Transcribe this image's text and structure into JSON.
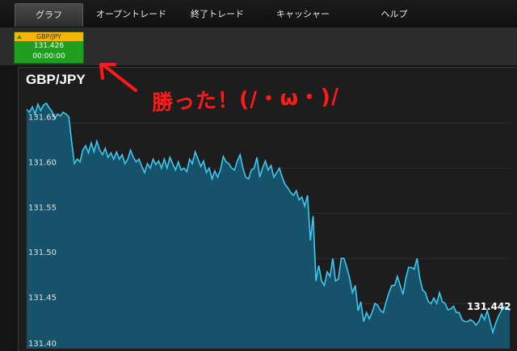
{
  "tabs": [
    {
      "label": "グラフ",
      "active": true
    },
    {
      "label": "オープントレード",
      "active": false
    },
    {
      "label": "終了トレード",
      "active": false
    },
    {
      "label": "キャッシャー",
      "active": false
    },
    {
      "label": "ヘルプ",
      "active": false
    }
  ],
  "ticker": {
    "symbol": "GBP/JPY",
    "price": "131.426",
    "timer": "00:00:00",
    "direction_icon": "up-triangle-icon",
    "header_color": "#f2b705",
    "body_color": "#1f9e1f"
  },
  "chart": {
    "title": "GBP/JPY",
    "annotation": "勝った！(/・ω・)/",
    "annotation_color": "#ff1a1a",
    "arrow_icon": "arrow-up-left-icon",
    "current_price_label": "131.442"
  },
  "chart_data": {
    "type": "area",
    "ylim": [
      131.4,
      131.68
    ],
    "ticks": [
      "131.65",
      "131.60",
      "131.55",
      "131.50",
      "131.45",
      "131.40"
    ],
    "tick_values": [
      131.65,
      131.6,
      131.55,
      131.5,
      131.45,
      131.4
    ],
    "grid": "horizontal",
    "fill_color": "#16536a",
    "line_color": "#3ec7ef",
    "values": [
      131.665,
      131.662,
      131.668,
      131.66,
      131.671,
      131.664,
      131.67,
      131.672,
      131.667,
      131.663,
      131.655,
      131.66,
      131.658,
      131.662,
      131.66,
      131.657,
      131.63,
      131.605,
      131.61,
      131.607,
      131.62,
      131.625,
      131.617,
      131.628,
      131.618,
      131.63,
      131.62,
      131.615,
      131.622,
      131.612,
      131.617,
      131.61,
      131.618,
      131.61,
      131.615,
      131.605,
      131.61,
      131.62,
      131.612,
      131.607,
      131.61,
      131.602,
      131.595,
      131.605,
      131.6,
      131.61,
      131.604,
      131.608,
      131.6,
      131.61,
      131.6,
      131.612,
      131.605,
      131.598,
      131.607,
      131.598,
      131.6,
      131.596,
      131.61,
      131.605,
      131.618,
      131.61,
      131.602,
      131.608,
      131.595,
      131.6,
      131.588,
      131.597,
      131.59,
      131.598,
      131.613,
      131.607,
      131.605,
      131.6,
      131.598,
      131.608,
      131.615,
      131.6,
      131.59,
      131.588,
      131.598,
      131.6,
      131.612,
      131.59,
      131.6,
      131.608,
      131.598,
      131.603,
      131.59,
      131.595,
      131.6,
      131.59,
      131.582,
      131.578,
      131.573,
      131.57,
      131.575,
      131.565,
      131.568,
      131.558,
      131.57,
      131.52,
      131.547,
      131.475,
      131.492,
      131.475,
      131.47,
      131.485,
      131.48,
      131.5,
      131.475,
      131.477,
      131.5,
      131.5,
      131.49,
      131.478,
      131.462,
      131.47,
      131.442,
      131.452,
      131.43,
      131.44,
      131.433,
      131.44,
      131.45,
      131.448,
      131.442,
      131.44,
      131.452,
      131.462,
      131.47,
      131.47,
      131.48,
      131.47,
      131.46,
      131.478,
      131.49,
      131.49,
      131.488,
      131.5,
      131.478,
      131.465,
      131.462,
      131.452,
      131.45,
      131.456,
      131.45,
      131.462,
      131.452,
      131.45,
      131.443,
      131.444,
      131.447,
      131.44,
      131.44,
      131.432,
      131.43,
      131.43,
      131.432,
      131.43,
      131.426,
      131.43,
      131.438,
      131.432,
      131.442,
      131.43,
      131.418,
      131.428,
      131.436,
      131.442,
      131.446,
      131.446,
      131.442
    ]
  }
}
